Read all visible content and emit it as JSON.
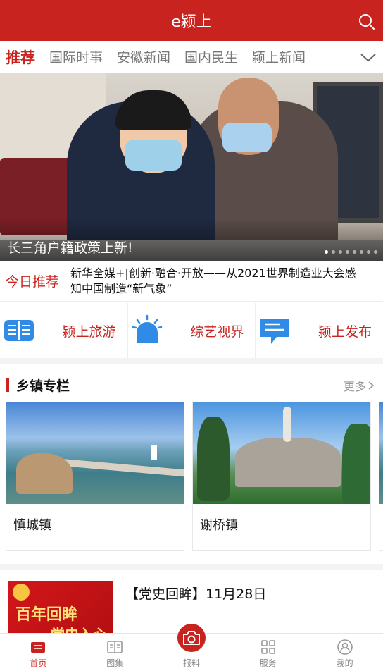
{
  "header": {
    "title": "e颍上",
    "search_icon": "search-icon"
  },
  "tabs": [
    {
      "label": "推荐",
      "active": true
    },
    {
      "label": "国际时事",
      "active": false
    },
    {
      "label": "安徽新闻",
      "active": false
    },
    {
      "label": "国内民生",
      "active": false
    },
    {
      "label": "颍上新闻",
      "active": false
    }
  ],
  "banner": {
    "caption": "长三角户籍政策上新!",
    "slide_count": 8,
    "current_slide": 1
  },
  "today": {
    "label": "今日推荐",
    "text": "新华全媒+|创新·融合·开放——从2021世界制造业大会感知中国制造“新气象”"
  },
  "quick_links": [
    {
      "label": "颍上旅游",
      "icon": "book-icon"
    },
    {
      "label": "综艺视界",
      "icon": "siren-icon"
    },
    {
      "label": "颍上发布",
      "icon": "message-icon"
    }
  ],
  "section": {
    "title": "乡镇专栏",
    "more": "更多"
  },
  "towns": [
    {
      "name": "慎城镇"
    },
    {
      "name": "谢桥镇"
    }
  ],
  "article": {
    "title": "【党史回眸】11月28日",
    "thumb_line1": "百年回眸",
    "thumb_line2": "党史入心"
  },
  "bottom_nav": [
    {
      "label": "首页",
      "icon": "home-icon",
      "active": true
    },
    {
      "label": "图集",
      "icon": "gallery-icon",
      "active": false
    },
    {
      "label": "报料",
      "icon": "camera-icon",
      "active": false
    },
    {
      "label": "服务",
      "icon": "grid-icon",
      "active": false
    },
    {
      "label": "我的",
      "icon": "user-icon",
      "active": false
    }
  ],
  "colors": {
    "brand": "#c8231e",
    "icon_blue": "#2f8be6"
  }
}
